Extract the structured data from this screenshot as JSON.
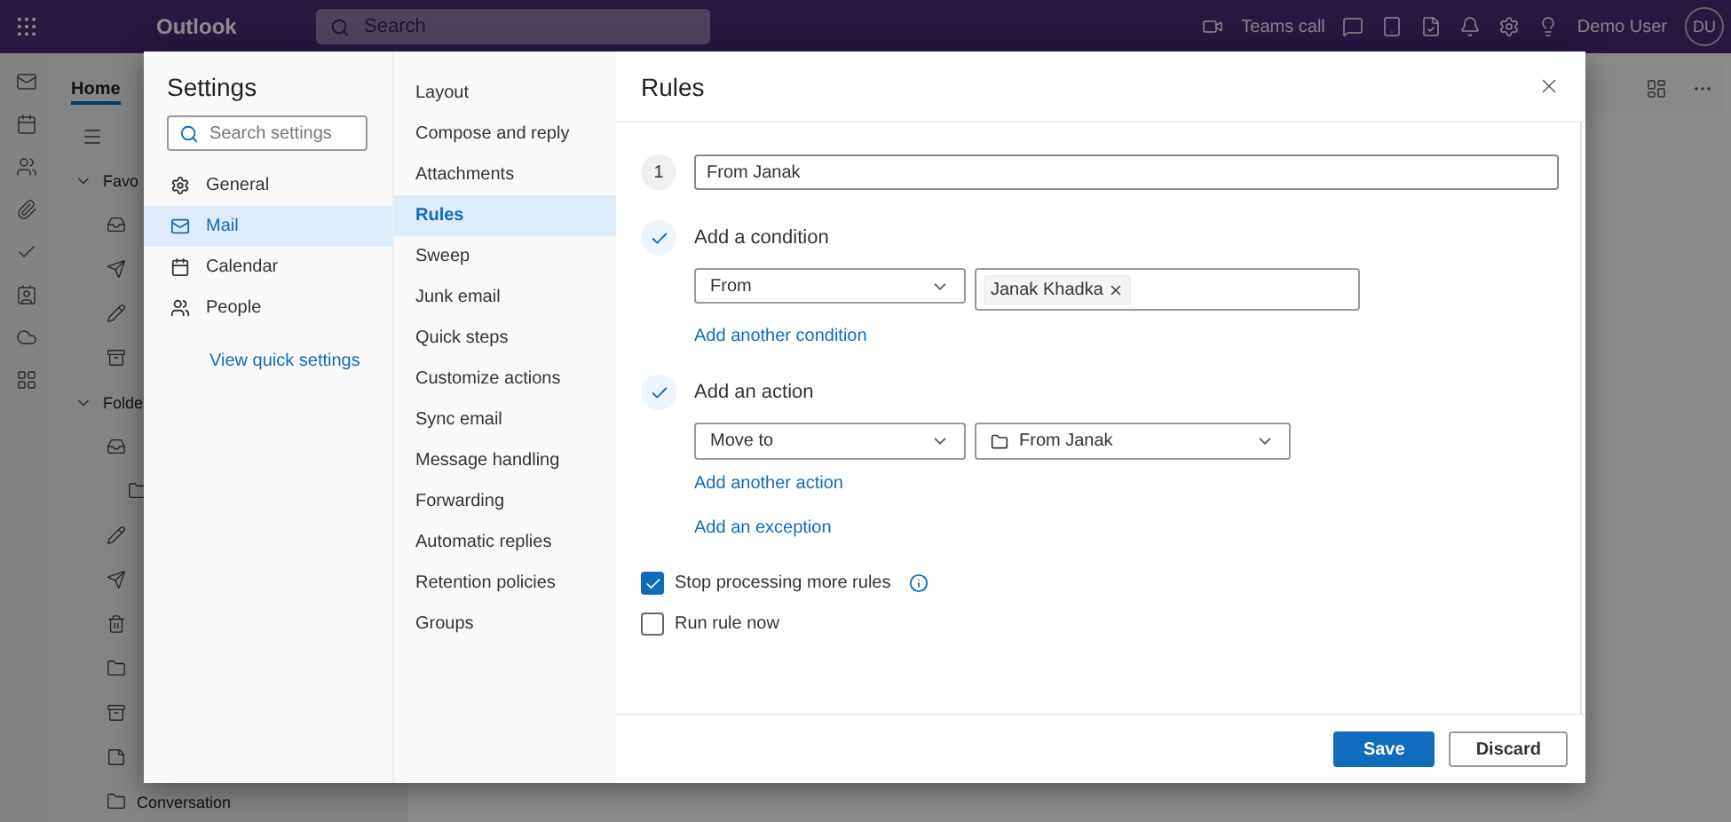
{
  "topbar": {
    "app_name": "Outlook",
    "search_placeholder": "Search",
    "teams_call": "Teams call",
    "user_name": "Demo User",
    "initials": "DU"
  },
  "background": {
    "tab": "Home",
    "sections": [
      "Favo",
      "Folde"
    ],
    "last_folder": "Conversation"
  },
  "settings": {
    "title": "Settings",
    "search_placeholder": "Search settings",
    "categories": [
      {
        "label": "General",
        "selected": false
      },
      {
        "label": "Mail",
        "selected": true
      },
      {
        "label": "Calendar",
        "selected": false
      },
      {
        "label": "People",
        "selected": false
      }
    ],
    "quick_link": "View quick settings",
    "subcategories": [
      {
        "label": "Layout",
        "selected": false
      },
      {
        "label": "Compose and reply",
        "selected": false
      },
      {
        "label": "Attachments",
        "selected": false
      },
      {
        "label": "Rules",
        "selected": true
      },
      {
        "label": "Sweep",
        "selected": false
      },
      {
        "label": "Junk email",
        "selected": false
      },
      {
        "label": "Quick steps",
        "selected": false
      },
      {
        "label": "Customize actions",
        "selected": false
      },
      {
        "label": "Sync email",
        "selected": false
      },
      {
        "label": "Message handling",
        "selected": false
      },
      {
        "label": "Forwarding",
        "selected": false
      },
      {
        "label": "Automatic replies",
        "selected": false
      },
      {
        "label": "Retention policies",
        "selected": false
      },
      {
        "label": "Groups",
        "selected": false
      }
    ]
  },
  "rules": {
    "title": "Rules",
    "step": "1",
    "rule_name": "From Janak",
    "condition": {
      "heading": "Add a condition",
      "done": true,
      "field": "From",
      "chip": "Janak Khadka",
      "add_link": "Add another condition"
    },
    "action": {
      "heading": "Add an action",
      "done": true,
      "field": "Move to",
      "folder": "From Janak",
      "add_link": "Add another action"
    },
    "exception_link": "Add an exception",
    "options": [
      {
        "label": "Stop processing more rules",
        "checked": true,
        "info": true
      },
      {
        "label": "Run rule now",
        "checked": false,
        "info": false
      }
    ],
    "buttons": [
      {
        "label": "Save",
        "kind": "primary"
      },
      {
        "label": "Discard",
        "kind": "secondary"
      }
    ]
  }
}
